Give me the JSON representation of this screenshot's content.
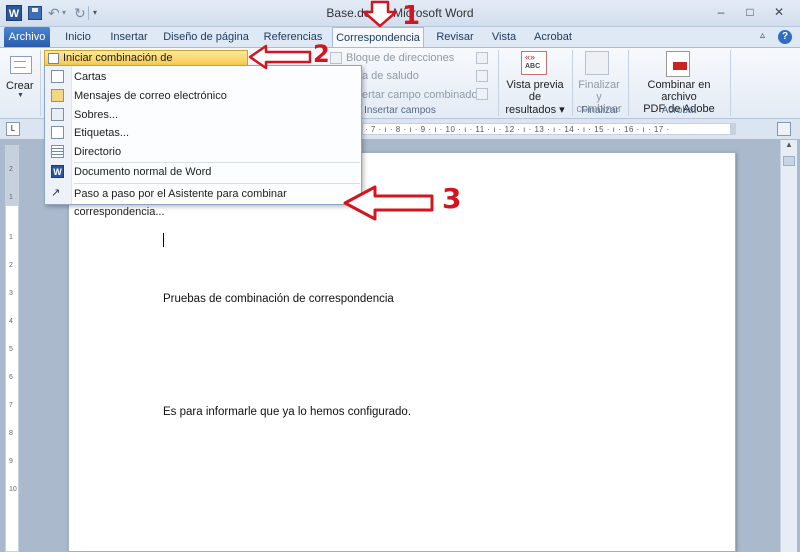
{
  "window": {
    "title": "Base.docx - Microsoft Word",
    "app_icon_letter": "W",
    "buttons": {
      "minimize": "–",
      "maximize": "□",
      "close": "✕"
    }
  },
  "quick_access": {
    "undo": "↶",
    "redo": "↻",
    "customize": "▾"
  },
  "tabs": [
    {
      "label": "Archivo",
      "active": false
    },
    {
      "label": "Inicio",
      "active": false
    },
    {
      "label": "Insertar",
      "active": false
    },
    {
      "label": "Diseño de página",
      "active": false
    },
    {
      "label": "Referencias",
      "active": false
    },
    {
      "label": "Correspondencia",
      "active": true
    },
    {
      "label": "Revisar",
      "active": false
    },
    {
      "label": "Vista",
      "active": false
    },
    {
      "label": "Acrobat",
      "active": false
    }
  ],
  "tab_right": {
    "expand": "▵",
    "help": "?"
  },
  "ribbon": {
    "crear": {
      "label": "Crear"
    },
    "start_merge": {
      "label": "Iniciar combinación de correspondencia ▾"
    },
    "fields": {
      "address_block": "Bloque de direcciones",
      "greeting": "a de saludo",
      "insert_field": "ertar campo combinado ▾",
      "group_label": "Insertar campos"
    },
    "preview": {
      "label_line1": "Vista previa de",
      "label_line2": "resultados ▾"
    },
    "finish": {
      "label_line1": "Finalizar y",
      "label_line2": "combinar ▾",
      "group_label": "Finalizar"
    },
    "acrobat": {
      "label_line1": "Combinar en archivo",
      "label_line2": "PDF de Adobe",
      "group_label": "Acrobat"
    }
  },
  "ruler": {
    "toggle": "L",
    "marks": "· 7 · ı · 8 · ı · 9 · ı · 10 · ı · 11 · ı · 12 · ı · 13 · ı · 14 · ı · 15 · ı · 16 · ı · 17 ·",
    "vertical_marks": [
      "2",
      "1",
      "1",
      "2",
      "3",
      "4",
      "5",
      "6",
      "7",
      "8",
      "9",
      "10"
    ]
  },
  "menu": {
    "items": [
      {
        "label": "Cartas"
      },
      {
        "label": "Mensajes de correo electrónico"
      },
      {
        "label": "Sobres..."
      },
      {
        "label": "Etiquetas..."
      },
      {
        "label": "Directorio"
      },
      {
        "label": "Documento normal de Word"
      },
      {
        "label": "Paso a paso por el Asistente para combinar correspondencia..."
      }
    ]
  },
  "document": {
    "paragraph1": "Pruebas de combinación de correspondencia",
    "paragraph2": "Es para informarle que ya lo hemos configurado."
  },
  "annotations": {
    "step1": "1",
    "step2": "2",
    "step3": "3"
  },
  "colors": {
    "annotation": "#d6141f",
    "accent": "#2b579a",
    "menu_highlight": "#f8c94c"
  }
}
